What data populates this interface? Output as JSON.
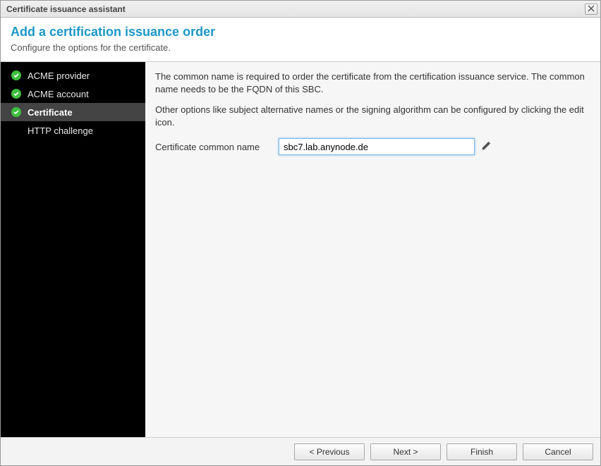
{
  "window": {
    "title": "Certificate issuance assistant"
  },
  "header": {
    "title": "Add a certification issuance order",
    "subtitle": "Configure the options for the certificate."
  },
  "sidebar": {
    "items": [
      {
        "label": "ACME provider",
        "done": true,
        "active": false
      },
      {
        "label": "ACME account",
        "done": true,
        "active": false
      },
      {
        "label": "Certificate",
        "done": true,
        "active": true
      },
      {
        "label": "HTTP challenge",
        "done": false,
        "active": false
      }
    ]
  },
  "content": {
    "paragraph1": "The common name is required to order the certificate from the certification issuance service. The common name needs to be the FQDN of this SBC.",
    "paragraph2": "Other options like subject alternative names or the signing algorithm can be configured by clicking the edit icon.",
    "form": {
      "common_name_label": "Certificate common name",
      "common_name_value": "sbc7.lab.anynode.de"
    }
  },
  "footer": {
    "previous": "< Previous",
    "next": "Next >",
    "finish": "Finish",
    "cancel": "Cancel"
  }
}
